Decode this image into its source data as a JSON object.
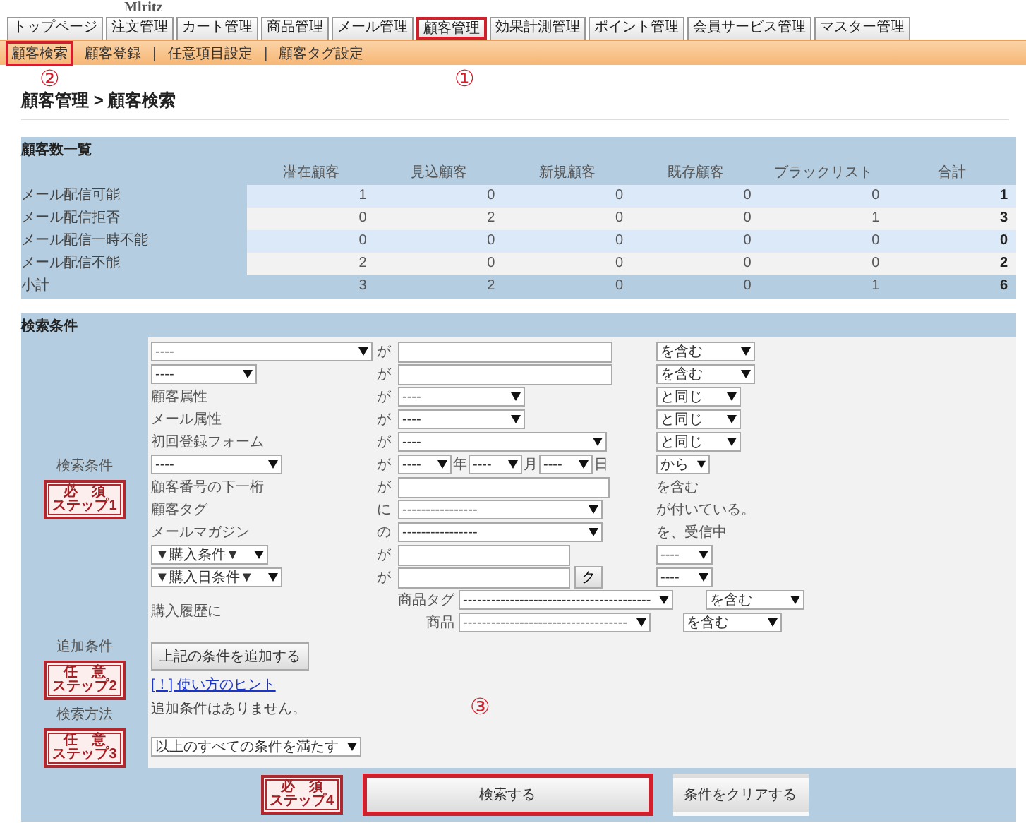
{
  "logo": {
    "text": "Mlritz"
  },
  "nav_tabs": [
    {
      "label": "トップページ",
      "highlighted": false
    },
    {
      "label": "注文管理",
      "highlighted": false
    },
    {
      "label": "カート管理",
      "highlighted": false
    },
    {
      "label": "商品管理",
      "highlighted": false
    },
    {
      "label": "メール管理",
      "highlighted": false
    },
    {
      "label": "顧客管理",
      "highlighted": true
    },
    {
      "label": "効果計測管理",
      "highlighted": false
    },
    {
      "label": "ポイント管理",
      "highlighted": false
    },
    {
      "label": "会員サービス管理",
      "highlighted": false
    },
    {
      "label": "マスター管理",
      "highlighted": false
    }
  ],
  "sub_nav": [
    {
      "label": "顧客検索",
      "highlighted": true
    },
    {
      "label": "顧客登録",
      "highlighted": false
    },
    {
      "prefix": "|",
      "label": "任意項目設定",
      "highlighted": false
    },
    {
      "prefix": "|",
      "label": "顧客タグ設定",
      "highlighted": false
    }
  ],
  "annotations": [
    {
      "label": "①"
    },
    {
      "label": "②"
    },
    {
      "label": "③"
    }
  ],
  "breadcrumb": "顧客管理 > 顧客検索",
  "customer_counts": {
    "title": "顧客数一覧",
    "columns": [
      "潜在顧客",
      "見込顧客",
      "新規顧客",
      "既存顧客",
      "ブラックリスト",
      "合計"
    ],
    "rows": [
      {
        "kind": "data",
        "label": "メール配信可能",
        "values": [
          "1",
          "0",
          "0",
          "0",
          "0",
          "1"
        ]
      },
      {
        "kind": "data",
        "label": "メール配信拒否",
        "values": [
          "0",
          "2",
          "0",
          "0",
          "1",
          "3"
        ]
      },
      {
        "kind": "data",
        "label": "メール配信一時不能",
        "values": [
          "0",
          "0",
          "0",
          "0",
          "0",
          "0"
        ]
      },
      {
        "kind": "data",
        "label": "メール配信不能",
        "values": [
          "2",
          "0",
          "0",
          "0",
          "0",
          "2"
        ]
      },
      {
        "kind": "subtotal",
        "label": "小計",
        "values": [
          "3",
          "2",
          "0",
          "0",
          "1",
          "6"
        ]
      }
    ]
  },
  "search": {
    "title": "検索条件",
    "conditions_label": "検索条件",
    "conditions_badge": {
      "top": "必　須",
      "bottom": "ステップ1"
    },
    "rows": [
      {
        "kind": "field",
        "lead": {
          "kind": "select",
          "text": "----"
        },
        "joiner": "が",
        "parts": [
          {
            "kind": "input"
          }
        ],
        "tail": {
          "kind": "select",
          "text": "を含む"
        }
      },
      {
        "kind": "field",
        "lead": {
          "kind": "select",
          "text": "----"
        },
        "joiner": "が",
        "parts": [
          {
            "kind": "input"
          }
        ],
        "tail": {
          "kind": "select",
          "text": "を含む"
        }
      },
      {
        "kind": "field",
        "lead": {
          "kind": "label",
          "text": "顧客属性"
        },
        "joiner": "が",
        "parts": [
          {
            "kind": "select",
            "text": "----"
          }
        ],
        "tail": {
          "kind": "select",
          "text": "と同じ"
        }
      },
      {
        "kind": "field",
        "lead": {
          "kind": "label",
          "text": "メール属性"
        },
        "joiner": "が",
        "parts": [
          {
            "kind": "select",
            "text": "----"
          }
        ],
        "tail": {
          "kind": "select",
          "text": "と同じ"
        }
      },
      {
        "kind": "field",
        "lead": {
          "kind": "label",
          "text": "初回登録フォーム"
        },
        "joiner": "が",
        "parts": [
          {
            "kind": "select",
            "text": "----"
          }
        ],
        "tail": {
          "kind": "select",
          "text": "と同じ"
        }
      },
      {
        "kind": "field",
        "lead": {
          "kind": "select",
          "text": "----"
        },
        "joiner": "が",
        "parts": [
          {
            "kind": "select",
            "text": "----"
          },
          {
            "kind": "text",
            "text": "年"
          },
          {
            "kind": "select",
            "text": "----"
          },
          {
            "kind": "text",
            "text": "月"
          },
          {
            "kind": "select",
            "text": "----"
          },
          {
            "kind": "text",
            "text": "日"
          }
        ],
        "tail": {
          "kind": "select",
          "text": "から"
        }
      },
      {
        "kind": "field",
        "lead": {
          "kind": "label",
          "text": "顧客番号の下一桁"
        },
        "joiner": "が",
        "parts": [
          {
            "kind": "input"
          }
        ],
        "tail": {
          "kind": "text",
          "text": "を含む"
        }
      },
      {
        "kind": "field",
        "lead": {
          "kind": "label",
          "text": "顧客タグ"
        },
        "joiner": "に",
        "parts": [
          {
            "kind": "select",
            "text": "----------------"
          }
        ],
        "tail": {
          "kind": "text",
          "text": "が付いている。"
        }
      },
      {
        "kind": "field",
        "lead": {
          "kind": "label",
          "text": "メールマガジン"
        },
        "joiner": "の",
        "parts": [
          {
            "kind": "select",
            "text": "----------------"
          }
        ],
        "tail": {
          "kind": "text",
          "text": "を、受信中"
        }
      },
      {
        "kind": "field",
        "lead": {
          "kind": "select",
          "text": "▼購入条件▼"
        },
        "joiner": "が",
        "parts": [
          {
            "kind": "input"
          }
        ],
        "tail": {
          "kind": "select",
          "text": "----"
        }
      },
      {
        "kind": "field",
        "lead": {
          "kind": "select",
          "text": "▼購入日条件▼"
        },
        "joiner": "が",
        "parts": [
          {
            "kind": "input"
          },
          {
            "kind": "button",
            "text": "ク"
          }
        ],
        "tail": {
          "kind": "select",
          "text": "----"
        }
      },
      {
        "kind": "history",
        "label": "購入履歴に",
        "lines": [
          {
            "prefix": "商品タグ",
            "select": "----------------------------------------",
            "tail": "を含む"
          },
          {
            "prefix": "商品",
            "select": "-----------------------------------",
            "tail": "を含む"
          }
        ]
      }
    ],
    "additional_label": "追加条件",
    "additional_badge": {
      "top": "任　意",
      "bottom": "ステップ2"
    },
    "add_button": "上記の条件を追加する",
    "hint_link": "[！] 使い方のヒント",
    "no_conditions": "追加条件はありません。",
    "method_label": "検索方法",
    "method_badge": {
      "top": "任　意",
      "bottom": "ステップ3"
    },
    "method_select": "以上のすべての条件を満たす",
    "submit_badge": {
      "top": "必　須",
      "bottom": "ステップ4"
    },
    "search_button": {
      "label": "検索する",
      "highlighted": true
    },
    "clear_button": {
      "label": "条件をクリアする",
      "highlighted": false
    }
  }
}
